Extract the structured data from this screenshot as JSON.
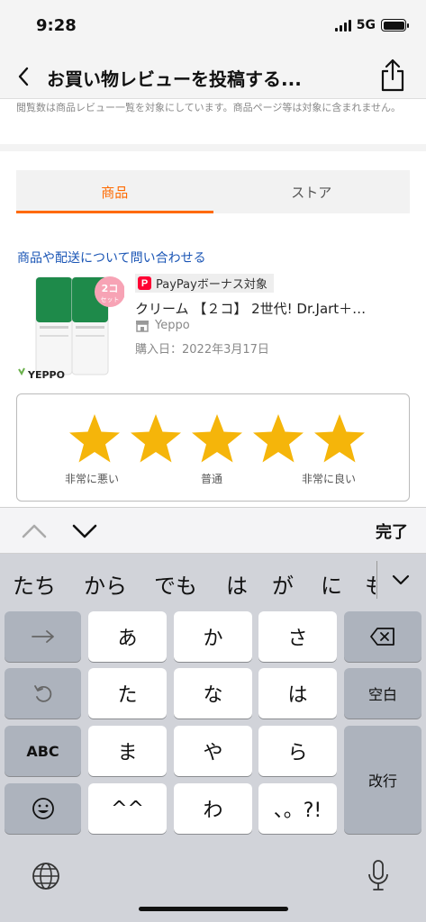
{
  "status": {
    "time": "9:28",
    "network": "5G"
  },
  "nav": {
    "title": "お買い物レビューを投稿する...",
    "back_icon": "chevron-left-icon",
    "share_icon": "share-icon"
  },
  "note": "閲覧数は商品レビュー一覧を対象にしています。商品ページ等は対象に含まれません。",
  "tabs": [
    {
      "label": "商品",
      "active": true
    },
    {
      "label": "ストア",
      "active": false
    }
  ],
  "inquiry_link": "商品や配送について問い合わせる",
  "product": {
    "image_badge": "2コ セット",
    "image_brand": "YEPPO",
    "bonus_label": "PayPayボーナス対象",
    "bonus_logo": "P",
    "name": "クリーム 【２コ】 2世代! Dr.Jart＋…",
    "store": "Yeppo",
    "purchase_date": "購入日：2022年3月17日"
  },
  "rating": {
    "star_count": 5,
    "star_color": "#f5b50a",
    "label_bad": "非常に悪い",
    "label_mid": "普通",
    "label_good": "非常に良い"
  },
  "keyboard_toolbar": {
    "done_label": "完了"
  },
  "keyboard": {
    "candidates": [
      "たち",
      "から",
      "でも",
      "は",
      "が",
      "に",
      "も"
    ],
    "keys": {
      "a": "あ",
      "ka": "か",
      "sa": "さ",
      "ta": "た",
      "na": "な",
      "ha": "は",
      "ma": "ま",
      "ya": "や",
      "ra": "ら",
      "kaomoji": "^^",
      "wa": "わ",
      "punct": "、。?!",
      "space": "空白",
      "abc": "ABC",
      "enter": "改行"
    }
  },
  "colors": {
    "accent": "#ff6a00",
    "link": "#1a55b5"
  }
}
